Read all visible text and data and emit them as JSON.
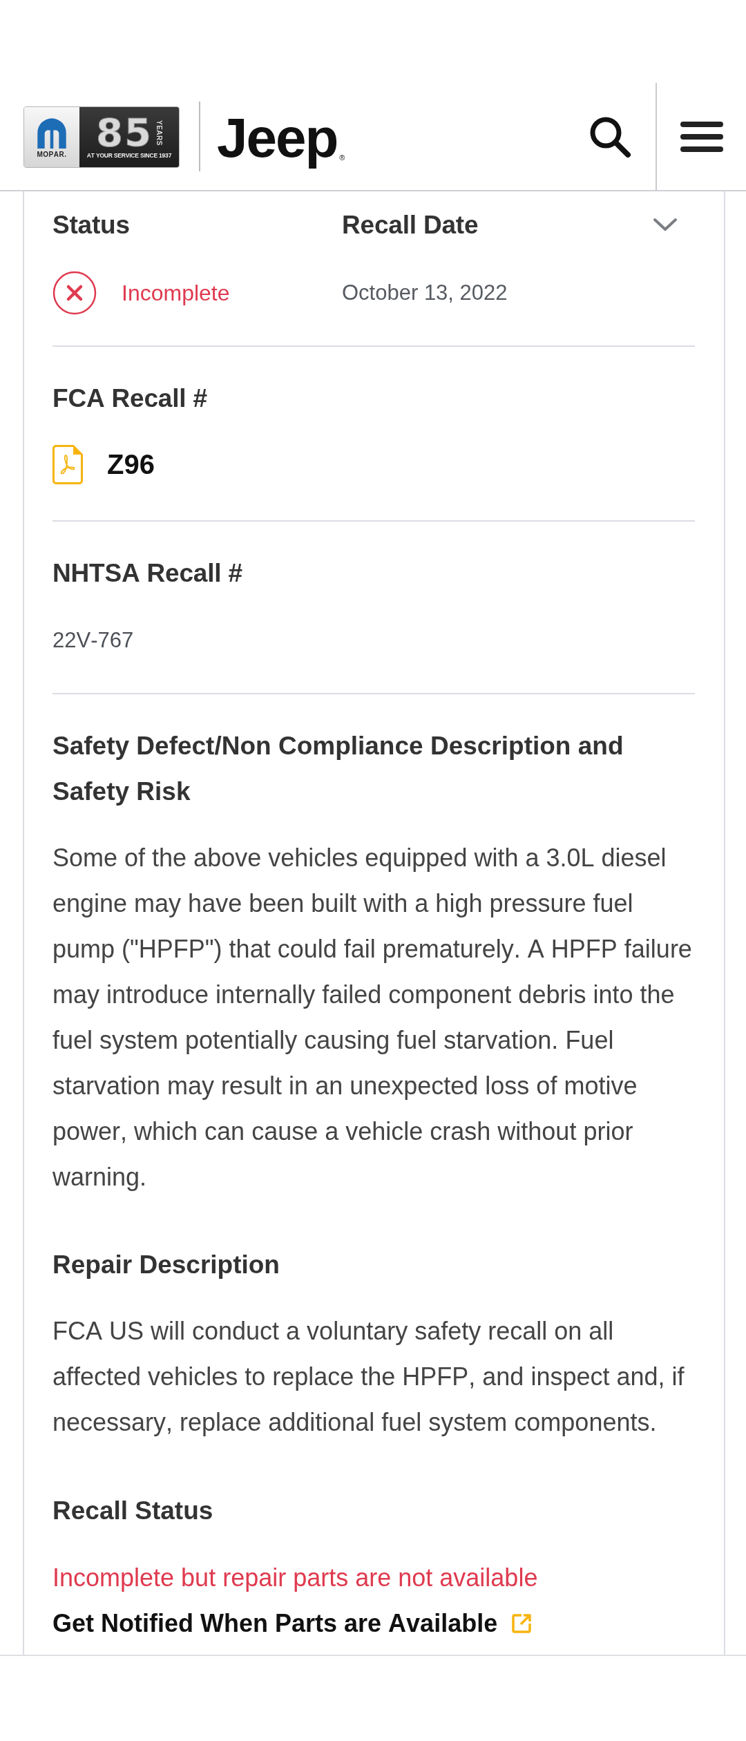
{
  "header": {
    "logo": {
      "emblem_text": "MOPAR.",
      "number": "85",
      "years": "YEARS",
      "tagline": "AT YOUR SERVICE SINCE 1937"
    },
    "brand_name": "Jeep",
    "registered_mark": "®"
  },
  "recall": {
    "status": {
      "label": "Status",
      "value": "Incomplete",
      "complete": false
    },
    "recall_date": {
      "label": "Recall Date",
      "value": "October 13, 2022"
    },
    "fca_recall": {
      "label": "FCA Recall #",
      "value": "Z96"
    },
    "nhtsa_recall": {
      "label": "NHTSA Recall #",
      "value": "22V-767"
    },
    "descriptions": [
      {
        "heading": "Safety Defect/Non Compliance Description and Safety Risk",
        "text": "Some of the above vehicles equipped with a 3.0L diesel engine may have been built with a high pressure fuel pump (\"HPFP\") that could fail prematurely. A HPFP failure may introduce internally failed component debris into the fuel system potentially causing fuel starvation. Fuel starvation may result in an unexpected loss of motive power, which can cause a vehicle crash without prior warning."
      },
      {
        "heading": "Repair Description",
        "text": "FCA US will conduct a voluntary safety recall on all affected vehicles to replace the HPFP, and inspect and, if necessary, replace additional fuel system components."
      }
    ],
    "recall_status": {
      "label": "Recall Status",
      "value": "Incomplete but repair parts are not available",
      "parts_available": false,
      "link": "Get Notified When Parts are Available"
    }
  }
}
